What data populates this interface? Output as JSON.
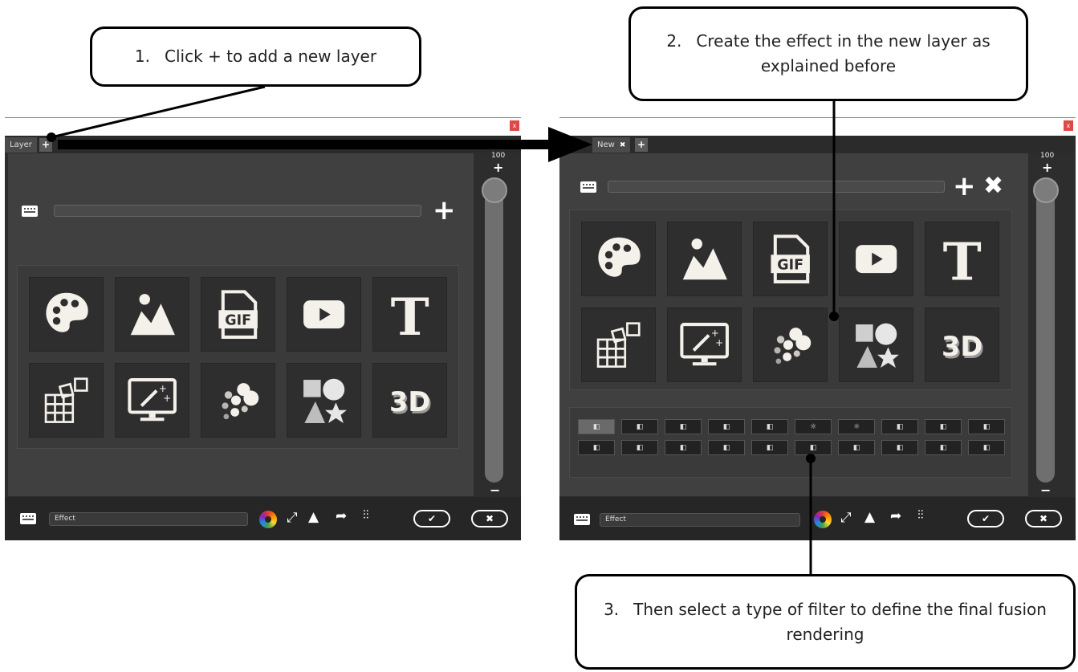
{
  "callouts": {
    "step1": {
      "num": "1.",
      "text": "Click + to add a new layer"
    },
    "step2": {
      "num": "2.",
      "text": "Create the effect in the new layer as explained before"
    },
    "step3": {
      "num": "3.",
      "text": "Then select a type of filter to define the final fusion rendering"
    }
  },
  "left_window": {
    "close_label": "x",
    "tabs": [
      {
        "label": "Layer"
      }
    ],
    "add_tab_label": "+",
    "add_layer_label": "+",
    "slider": {
      "max_label": "100",
      "plus": "+",
      "minus": "−",
      "value_percent": 100
    },
    "bottom": {
      "effect_value": "Effect",
      "ok_label": "✔",
      "cancel_label": "✖"
    }
  },
  "right_window": {
    "close_label": "x",
    "tabs": [
      {
        "label": "New",
        "close": "✖"
      }
    ],
    "add_tab_label": "+",
    "add_layer_label": "+",
    "delete_layer_label": "✖",
    "slider": {
      "max_label": "100",
      "plus": "+",
      "minus": "−",
      "value_percent": 100
    },
    "bottom": {
      "effect_value": "Effect",
      "ok_label": "✔",
      "cancel_label": "✖"
    }
  },
  "effect_tiles": [
    {
      "name": "palette-icon"
    },
    {
      "name": "image-icon"
    },
    {
      "name": "gif-icon",
      "text": "GIF"
    },
    {
      "name": "video-icon"
    },
    {
      "name": "text-icon",
      "text": "T"
    },
    {
      "name": "mosaic-icon"
    },
    {
      "name": "magic-screen-icon"
    },
    {
      "name": "particles-icon"
    },
    {
      "name": "shapes-icon"
    },
    {
      "name": "3d-icon",
      "text": "3D"
    }
  ],
  "fusion_filters_count": 20,
  "colors": {
    "window_bg": "#2d2d2d",
    "panel_bg": "#404040",
    "accent_line": "#4aa3b8",
    "close_red": "#e04848"
  }
}
